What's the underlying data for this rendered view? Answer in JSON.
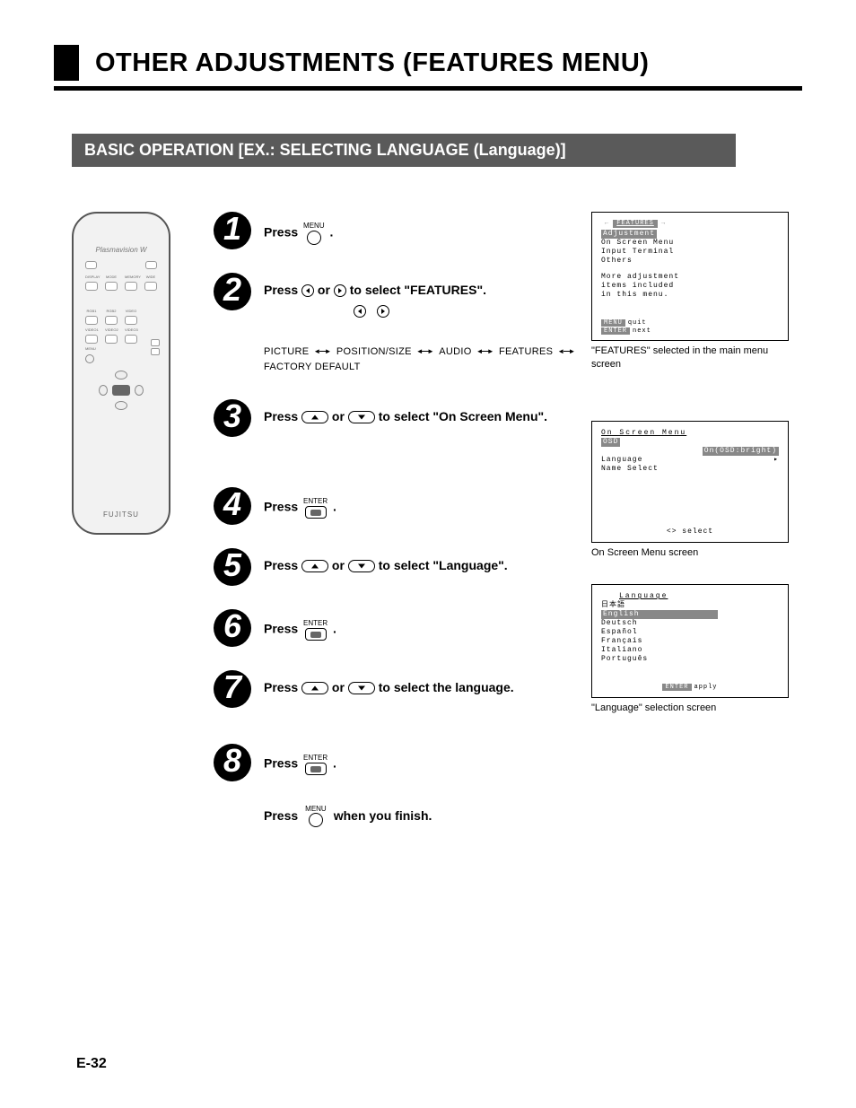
{
  "page_title": "OTHER ADJUSTMENTS (FEATURES MENU)",
  "subhead": "BASIC OPERATION [EX.: SELECTING LANGUAGE (Language)]",
  "remote": {
    "brand": "Plasmavision W",
    "logo": "FUJITSU",
    "row1": [
      "",
      "",
      ""
    ],
    "row2lbl": [
      "DISPLAY",
      "MODE",
      "MEMORY",
      "WIDE"
    ],
    "row3lbl": [
      "RGB1",
      "RGB2",
      "VIDEO"
    ],
    "row4lbl": [
      "VIDEO1",
      "VIDEO2",
      "VIDEO3"
    ],
    "menu_lbl": "MENU"
  },
  "button_labels": {
    "menu": "MENU",
    "enter": "ENTER"
  },
  "steps": {
    "s1": {
      "num": "1",
      "pre": "Press ",
      "post": " ."
    },
    "s2": {
      "num": "2",
      "pre": "Press ",
      "mid": " or ",
      "post": " to select \"FEATURES\"."
    },
    "s3": {
      "num": "3",
      "pre": "Press ",
      "mid": " or ",
      "post": " to select \"On Screen Menu\"."
    },
    "s4": {
      "num": "4",
      "pre": "Press ",
      "post": " ."
    },
    "s5": {
      "num": "5",
      "pre": "Press ",
      "mid": " or ",
      "post": " to select \"Language\"."
    },
    "s6": {
      "num": "6",
      "pre": "Press ",
      "post": " ."
    },
    "s7": {
      "num": "7",
      "pre": "Press ",
      "mid": " or ",
      "post": " to select the language."
    },
    "s8": {
      "num": "8",
      "pre": "Press ",
      "post": " ."
    }
  },
  "nav_chain": [
    "PICTURE",
    "POSITION/SIZE",
    "AUDIO",
    "FEATURES",
    "FACTORY DEFAULT"
  ],
  "finish": {
    "pre": "Press ",
    "post": " when you finish."
  },
  "screen1": {
    "tabs": [
      "←",
      "FEATURES",
      "→"
    ],
    "lines": [
      "Adjustment",
      "On Screen Menu",
      "Input Terminal",
      "Others",
      "",
      "More adjustment",
      "items included",
      "in this menu."
    ],
    "footer": [
      [
        "MENU",
        "quit"
      ],
      [
        "ENTER",
        "next"
      ]
    ],
    "caption": "\"FEATURES\" selected in the main menu screen"
  },
  "screen2": {
    "title": "On Screen Menu",
    "lines": [
      "OSD",
      "  On(OSD:bright)",
      "Language",
      "Name Select"
    ],
    "footer_text": "<> select",
    "caption": "On Screen Menu screen"
  },
  "screen3": {
    "title": "Language",
    "lines": [
      "日本語",
      "English",
      "Deutsch",
      "Español",
      "Français",
      "Italiano",
      "Português"
    ],
    "footer": [
      [
        "ENTER",
        "apply"
      ]
    ],
    "caption": "\"Language\" selection screen"
  },
  "page_number": "E-32"
}
